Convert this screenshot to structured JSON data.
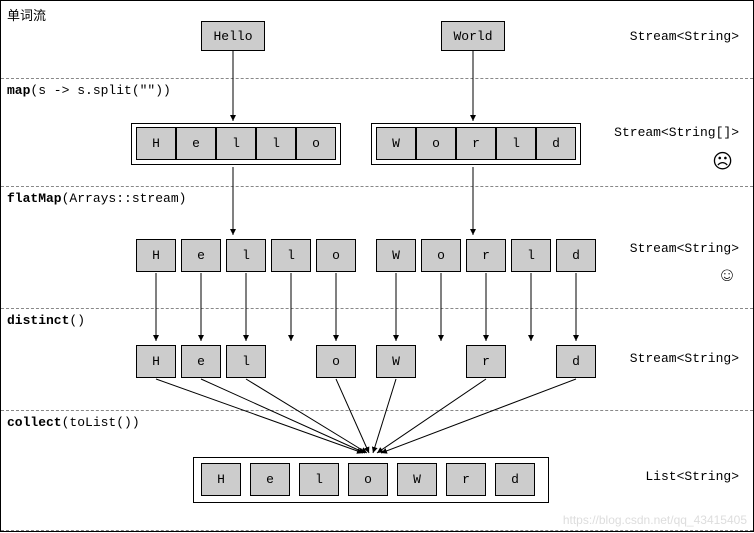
{
  "title": "单词流",
  "stages": {
    "source": {
      "words": [
        "Hello",
        "World"
      ],
      "type": "Stream<String>"
    },
    "map": {
      "op_bold": "map",
      "op_rest": "(s -> s.split(\"\"))",
      "arrays": [
        [
          "H",
          "e",
          "l",
          "l",
          "o"
        ],
        [
          "W",
          "o",
          "r",
          "l",
          "d"
        ]
      ],
      "type": "Stream<String[]>",
      "face": "☹"
    },
    "flatmap": {
      "op_bold": "flatMap",
      "op_rest": "(Arrays::stream)",
      "chars": [
        "H",
        "e",
        "l",
        "l",
        "o",
        "W",
        "o",
        "r",
        "l",
        "d"
      ],
      "type": "Stream<String>",
      "face": "☺"
    },
    "distinct": {
      "op_bold": "distinct",
      "op_rest": "()",
      "chars": [
        "H",
        "e",
        "l",
        "o",
        "W",
        "r",
        "d"
      ],
      "type": "Stream<String>"
    },
    "collect": {
      "op_bold": "collect",
      "op_rest": "(toList())",
      "chars": [
        "H",
        "e",
        "l",
        "o",
        "W",
        "r",
        "d"
      ],
      "type": "List<String>"
    }
  },
  "watermark": "https://blog.csdn.net/qq_43415405"
}
